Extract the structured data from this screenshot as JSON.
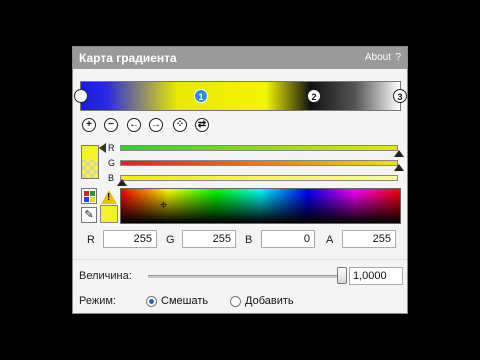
{
  "window": {
    "title": "Карта градиента",
    "about": "About",
    "help": "?"
  },
  "gradient": {
    "stops": [
      {
        "label": "",
        "color": "#ffffff"
      },
      {
        "label": "1",
        "color": "#2a8be0"
      },
      {
        "label": "2",
        "color": "#ffffff"
      },
      {
        "label": "3",
        "color": "#ffffff"
      }
    ]
  },
  "toolbar": {
    "icons": [
      "add-stop-icon",
      "remove-stop-icon",
      "move-left-icon",
      "move-right-icon",
      "distribute-icon",
      "reverse-icon"
    ]
  },
  "channels": [
    {
      "label": "R",
      "value": 255
    },
    {
      "label": "G",
      "value": 255
    },
    {
      "label": "B",
      "value": 0
    }
  ],
  "rgba": {
    "r_label": "R",
    "r": "255",
    "g_label": "G",
    "g": "255",
    "b_label": "B",
    "b": "0",
    "a_label": "A",
    "a": "255"
  },
  "size": {
    "label": "Величина:",
    "value": "1,0000",
    "fraction": 1.0
  },
  "mode": {
    "label": "Режим:",
    "options": [
      {
        "label": "Смешать",
        "selected": true
      },
      {
        "label": "Добавить",
        "selected": false
      }
    ]
  },
  "colors": {
    "accent": "#2a64c8",
    "current": "#f3f12a",
    "titlebar": "#9a9a9a"
  }
}
